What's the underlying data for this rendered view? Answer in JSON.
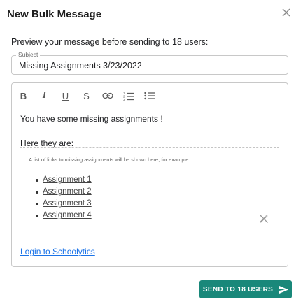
{
  "dialog": {
    "title": "New Bulk Message",
    "close_icon": "close-icon"
  },
  "preview": {
    "text": "Preview your message before sending to 18 users:"
  },
  "subject": {
    "label": "Subject",
    "value": "Missing Assignments 3/23/2022"
  },
  "toolbar": {
    "items": [
      {
        "name": "bold",
        "glyph": "B",
        "icon": "bold-icon"
      },
      {
        "name": "italic",
        "glyph": "I",
        "icon": "italic-icon"
      },
      {
        "name": "underline",
        "glyph": "U",
        "icon": "underline-icon"
      },
      {
        "name": "strikethrough",
        "glyph": "S",
        "icon": "strikethrough-icon"
      },
      {
        "name": "link",
        "icon": "link-icon"
      },
      {
        "name": "numbered-list",
        "icon": "numbered-list-icon"
      },
      {
        "name": "bulleted-list",
        "icon": "bulleted-list-icon"
      }
    ]
  },
  "editor": {
    "line1": "You have some missing assignments !",
    "line2": "Here they are:",
    "placeholder_hint": "A list of links to missing assignments will be shown here, for example:",
    "assignments": [
      "Assignment 1",
      "Assignment 2",
      "Assignment 3",
      "Assignment 4"
    ],
    "wand_icon": "magic-wand-off-icon",
    "login_link": "Login to Schoolytics"
  },
  "send_button": {
    "label": "SEND TO 18 USERS",
    "icon": "send-icon"
  },
  "colors": {
    "accent": "#19887a",
    "link": "#1a73e8",
    "border": "#c8c8c8"
  }
}
